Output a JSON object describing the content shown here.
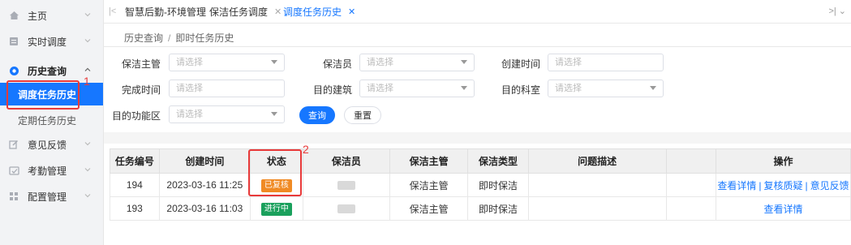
{
  "sidebar": {
    "items": [
      {
        "label": "主页",
        "icon": "home-icon"
      },
      {
        "label": "实时调度",
        "icon": "monitor-icon"
      },
      {
        "label": "历史查询",
        "icon": "history-icon"
      },
      {
        "label": "调度任务历史"
      },
      {
        "label": "定期任务历史"
      },
      {
        "label": "意见反馈",
        "icon": "edit-icon"
      },
      {
        "label": "考勤管理",
        "icon": "attendance-icon"
      },
      {
        "label": "配置管理",
        "icon": "grid-icon"
      }
    ]
  },
  "tabs": [
    {
      "label": "智慧后勤-环境管理",
      "closable": false
    },
    {
      "label": "保洁任务调度",
      "closable": true
    },
    {
      "label": "调度任务历史",
      "closable": true,
      "active": true
    }
  ],
  "breadcrumb": [
    "历史查询",
    "即时任务历史"
  ],
  "annotations": [
    "1",
    "2"
  ],
  "form": {
    "supervisor_label": "保洁主管",
    "supervisor_placeholder": "请选择",
    "cleaner_label": "保洁员",
    "cleaner_placeholder": "请选择",
    "created_label": "创建时间",
    "created_placeholder": "请选择",
    "finished_label": "完成时间",
    "finished_placeholder": "请选择",
    "building_label": "目的建筑",
    "building_placeholder": "请选择",
    "department_label": "目的科室",
    "department_placeholder": "请选择",
    "area_label": "目的功能区",
    "area_placeholder": "请选择",
    "query_button": "查询",
    "reset_button": "重置"
  },
  "table": {
    "headers": [
      "任务编号",
      "创建时间",
      "状态",
      "保洁员",
      "保洁主管",
      "保洁类型",
      "问题描述",
      "",
      "操作"
    ],
    "rows": [
      {
        "id": "194",
        "created": "2023-03-16 11:25",
        "status": "已复核",
        "status_color": "#f08a24",
        "supervisor": "保洁主管",
        "type": "即时保洁",
        "description": "",
        "actions": [
          "查看详情",
          "复核质疑",
          "意见反馈"
        ]
      },
      {
        "id": "193",
        "created": "2023-03-16 11:03",
        "status": "进行中",
        "status_color": "#1aa05c",
        "supervisor": "保洁主管",
        "type": "即时保洁",
        "description": "",
        "actions": [
          "查看详情"
        ]
      }
    ]
  },
  "colors": {
    "accent": "#1677ff",
    "highlight": "#e83a3a"
  }
}
